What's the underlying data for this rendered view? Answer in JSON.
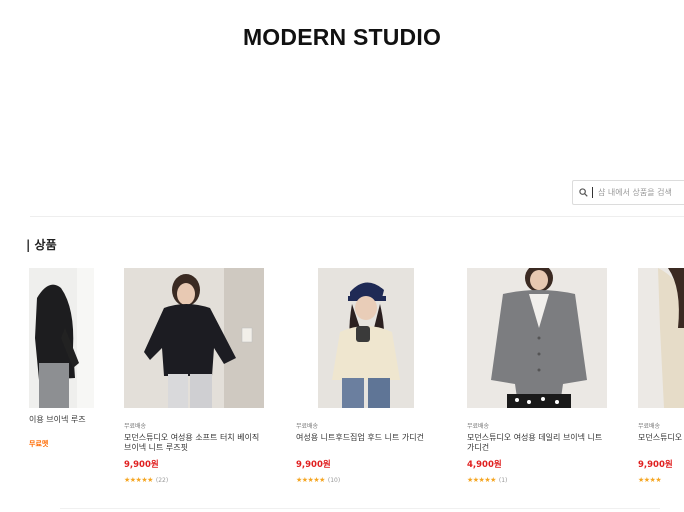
{
  "header": {
    "brand": "MODERN STUDIO"
  },
  "search": {
    "value": "",
    "placeholder": "샵 내에서 상품을 검색"
  },
  "section": {
    "title": "| 상품"
  },
  "left_partial": {
    "name": "이용 브이넥 루즈",
    "promo": "무료멧"
  },
  "products": [
    {
      "badge": "무료배송",
      "name": "모던스튜디오 여성용 소프트 터치 베이직 브이넥 니트 루즈핏",
      "price": "9,900원",
      "stars": "★★★★★",
      "count": "(22)"
    },
    {
      "badge": "무료배송",
      "name": "여성용 니트후드집업 후드 니트 가디건",
      "price": "9,900원",
      "stars": "★★★★★",
      "count": "(10)"
    },
    {
      "badge": "무료배송",
      "name": "모던스튜디오 여성용 데일리 브이넥 니트 가디건",
      "price": "4,900원",
      "stars": "★★★★★",
      "count": "(1)"
    },
    {
      "badge": "무료배송",
      "name": "모던스튜디오 프트 브이넥",
      "price": "9,900원",
      "stars": "★★★★",
      "count": ""
    }
  ],
  "colors": {
    "price": "#e02020",
    "star": "#f5a623",
    "promo": "#ff6a00"
  }
}
